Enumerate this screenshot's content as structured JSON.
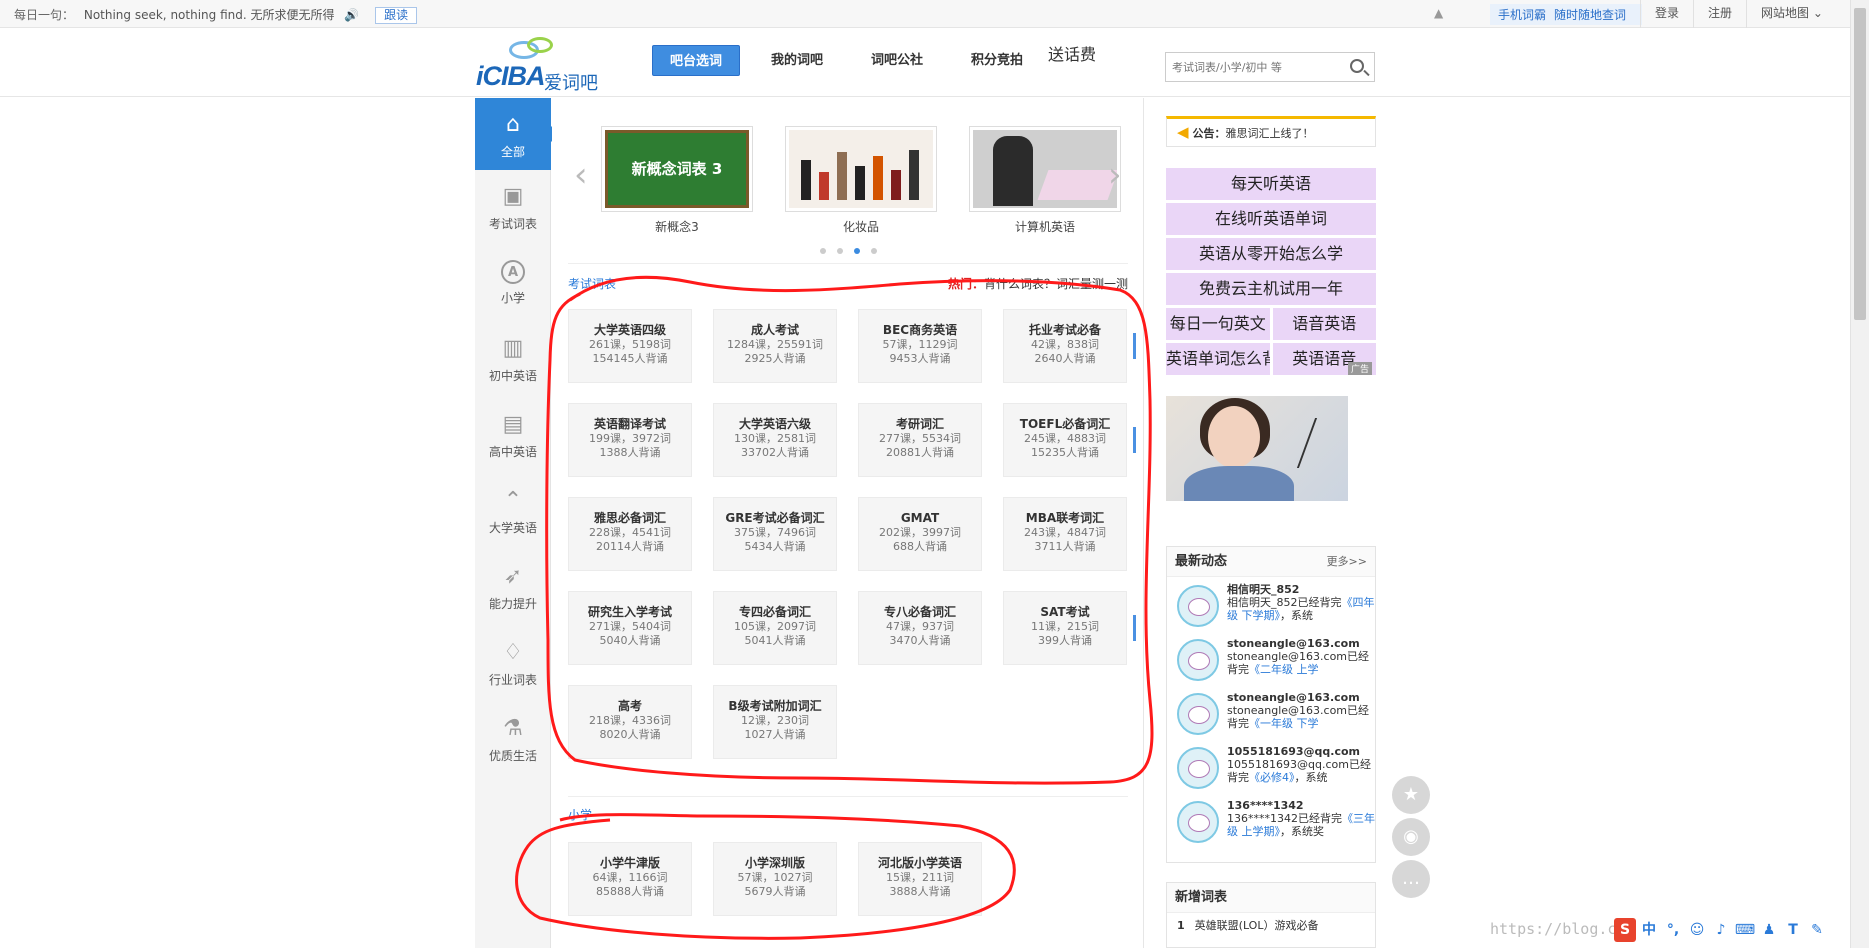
{
  "topbar": {
    "daily_label": "每日一句：",
    "daily_text": "Nothing seek, nothing find. 无所求便无所得",
    "follow": "跟读",
    "mobile_left": "手机词霸",
    "mobile_right": "随时随地查词",
    "links": [
      "登录",
      "注册",
      "网站地图 ⌄"
    ]
  },
  "header": {
    "brand": "iCIBA",
    "brand_cn": "爱词吧",
    "nav": [
      "吧台选词",
      "我的词吧",
      "词吧公社",
      "积分竞拍"
    ],
    "nav_badge": "送话费",
    "search_placeholder": "考试词表/小学/初中 等"
  },
  "sidebar": [
    "全部",
    "考试词表",
    "小学",
    "初中英语",
    "高中英语",
    "大学英语",
    "能力提升",
    "行业词表",
    "优质生活"
  ],
  "sidebar_icons": [
    "home-icon",
    "book-icon",
    "letter-a-icon",
    "open-book-icon",
    "book-shelf-icon",
    "graduation-cap-icon",
    "rocket-icon",
    "tie-icon",
    "flask-icon"
  ],
  "carousel": {
    "slides": [
      {
        "caption": "新概念3",
        "image_text": "新概念词表 3"
      },
      {
        "caption": "化妆品",
        "image_text": ""
      },
      {
        "caption": "计算机英语",
        "image_text": ""
      }
    ],
    "active_dot": 2
  },
  "exam": {
    "title": "考试词表",
    "hot_label": "热门：",
    "hot_text": "背什么词表？词汇量测一测",
    "cards": [
      {
        "name": "大学英语四级",
        "stat1": "261课，5198词",
        "stat2": "154145人背诵"
      },
      {
        "name": "成人考试",
        "stat1": "1284课，25591词",
        "stat2": "2925人背诵"
      },
      {
        "name": "BEC商务英语",
        "stat1": "57课，1129词",
        "stat2": "9453人背诵"
      },
      {
        "name": "托业考试必备",
        "stat1": "42课，838词",
        "stat2": "2640人背诵"
      },
      {
        "name": "英语翻译考试",
        "stat1": "199课，3972词",
        "stat2": "1388人背诵"
      },
      {
        "name": "大学英语六级",
        "stat1": "130课，2581词",
        "stat2": "33702人背诵"
      },
      {
        "name": "考研词汇",
        "stat1": "277课，5534词",
        "stat2": "20881人背诵"
      },
      {
        "name": "TOEFL必备词汇",
        "stat1": "245课，4883词",
        "stat2": "15235人背诵"
      },
      {
        "name": "雅思必备词汇",
        "stat1": "228课，4541词",
        "stat2": "20114人背诵"
      },
      {
        "name": "GRE考试必备词汇",
        "stat1": "375课，7496词",
        "stat2": "5434人背诵"
      },
      {
        "name": "GMAT",
        "stat1": "202课，3997词",
        "stat2": "688人背诵"
      },
      {
        "name": "MBA联考词汇",
        "stat1": "243课，4847词",
        "stat2": "3711人背诵"
      },
      {
        "name": "研究生入学考试",
        "stat1": "271课，5404词",
        "stat2": "5040人背诵"
      },
      {
        "name": "专四必备词汇",
        "stat1": "105课，2097词",
        "stat2": "5041人背诵"
      },
      {
        "name": "专八必备词汇",
        "stat1": "47课，937词",
        "stat2": "3470人背诵"
      },
      {
        "name": "SAT考试",
        "stat1": "11课，215词",
        "stat2": "399人背诵"
      },
      {
        "name": "高考",
        "stat1": "218课，4336词",
        "stat2": "8020人背诵"
      },
      {
        "name": "B级考试附加词汇",
        "stat1": "12课，230词",
        "stat2": "1027人背诵"
      }
    ]
  },
  "primary": {
    "title": "小学",
    "cards": [
      {
        "name": "小学牛津版",
        "stat1": "64课，1166词",
        "stat2": "85888人背诵"
      },
      {
        "name": "小学深圳版",
        "stat1": "57课，1027词",
        "stat2": "5679人背诵"
      },
      {
        "name": "河北版小学英语",
        "stat1": "15课，211词",
        "stat2": "3888人背诵"
      }
    ]
  },
  "right": {
    "notice_label": "公告：",
    "notice_text": "雅思词汇上线了！",
    "ads": [
      [
        "每天听英语"
      ],
      [
        "在线听英语单词"
      ],
      [
        "英语从零开始怎么学"
      ],
      [
        "免费云主机试用一年"
      ],
      [
        "每日一句英文",
        "语音英语"
      ],
      [
        "英语单词怎么背",
        "英语语音"
      ]
    ],
    "ad_tag": "广告",
    "feed_title": "最新动态",
    "feed_more": "更多>>",
    "feed": [
      {
        "user": "相信明天_852",
        "text": "相信明天_852已经背完",
        "book": "《四年级 下学期》",
        "tail": "，系统"
      },
      {
        "user": "stoneangle@163.com",
        "text": "stoneangle@163.com已经背完",
        "book": "《二年级 上学",
        "tail": ""
      },
      {
        "user": "stoneangle@163.com",
        "text": "stoneangle@163.com已经背完",
        "book": "《一年级 下学",
        "tail": ""
      },
      {
        "user": "1055181693@qq.com",
        "text": "1055181693@qq.com已经背完",
        "book": "《必修4》",
        "tail": "，系统"
      },
      {
        "user": "136****1342",
        "text": "136****1342已经背完",
        "book": "《三年级 上学期》",
        "tail": "，系统奖"
      }
    ],
    "new_title": "新增词表",
    "new_items": [
      {
        "index": "1",
        "name": "英雄联盟(LOL）游戏必备"
      }
    ]
  },
  "watermark": "https://blog.csdn.net/...",
  "colors": {
    "accent": "#3f8de0",
    "annotation": "#ff1a1a",
    "ad_bg": "#ead6f7",
    "hot": "#e02020"
  }
}
